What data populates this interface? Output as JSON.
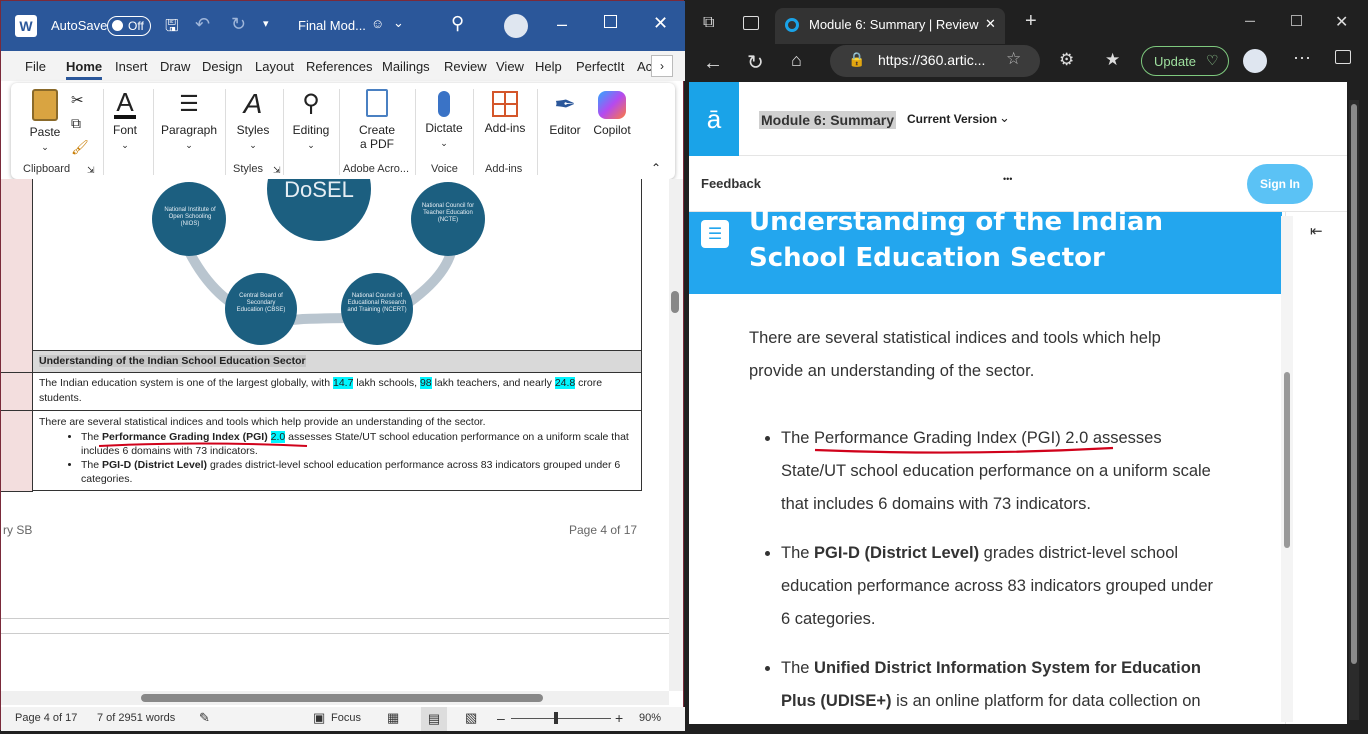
{
  "word": {
    "autosave_label": "AutoSave",
    "autosave_state": "Off",
    "doc_title": "Final Mod...",
    "menu": [
      "File",
      "Home",
      "Insert",
      "Draw",
      "Design",
      "Layout",
      "References",
      "Mailings",
      "Review",
      "View",
      "Help",
      "PerfectIt",
      "Ac"
    ],
    "ribbon": {
      "paste": "Paste",
      "font": "Font",
      "paragraph": "Paragraph",
      "styles": "Styles",
      "editing": "Editing",
      "create_pdf_1": "Create",
      "create_pdf_2": "a PDF",
      "dictate": "Dictate",
      "addins": "Add-ins",
      "editor": "Editor",
      "copilot": "Copilot"
    },
    "groups": {
      "clipboard": "Clipboard",
      "styles": "Styles",
      "adobe": "Adobe Acro...",
      "voice": "Voice",
      "addins": "Add-ins"
    },
    "diagram": {
      "center": "DoSEL",
      "nios": "National Institute of Open Schooling (NIOS)",
      "ncte": "National Council for Teacher Education (NCTE)",
      "cbse": "Central Board of Secondary Education (CBSE)",
      "ncert": "National Council of Educational Research and Training (NCERT)"
    },
    "table": {
      "heading": "Understanding of the Indian School Education Sector",
      "p1_a": "The Indian education system is one of the largest globally, with ",
      "p1_n1": "14.7",
      "p1_b": " lakh schools, ",
      "p1_n2": "98",
      "p1_c": " lakh teachers, and nearly ",
      "p1_n3": "24.8",
      "p1_d": " crore students.",
      "p2": "There are several statistical indices and tools which help provide an understanding of the sector.",
      "b1_a": "The ",
      "b1_bold": "Performance Grading Index (PGI) ",
      "b1_num": "2.0",
      "b1_b": " assesses State/UT school education performance on a uniform scale that includes 6 domains with 73 indicators.",
      "b2_a": "The ",
      "b2_bold": "PGI-D (District Level)",
      "b2_b": " grades district-level school education performance across 83 indicators grouped under 6 categories."
    },
    "footer_left": "ry SB",
    "footer_right": "Page 4 of 17",
    "status": {
      "page": "Page 4 of 17",
      "words": "7 of 2951 words",
      "focus": "Focus",
      "zoom": "90%"
    }
  },
  "browser": {
    "tab_title": "Module 6: Summary | Review 360",
    "url": "https://360.artic...",
    "update_label": "Update",
    "module_title": "Module 6: Summary",
    "version": "Current Version",
    "feedback": "Feedback",
    "more": "•••",
    "signin": "Sign In",
    "banner_line1": "Understanding of the Indian",
    "banner_line2": "School Education Sector",
    "intro": "There are several statistical indices and tools which help provide an understanding of the sector.",
    "b1_a": "The ",
    "b1_u": "Performance Grading Index (PGI) 2.0 as",
    "b1_b": "sesses State/UT school education performance on a uniform scale that includes 6  domains with  73 indicators.",
    "b2_a": "The ",
    "b2_bold": "PGI-D (District Level)",
    "b2_b": " grades district-level school education performance across 83 indicators grouped under 6 categories.",
    "b3_a": "The ",
    "b3_bold": "Unified District Information System for Education Plus (UDISE+)",
    "b3_b": " is an online platform for data collection on"
  },
  "colors": {
    "word_blue": "#2b579a",
    "accent_blue": "#23a6ee",
    "highlight": "#00f5ff",
    "diagram_teal": "#1c5f80"
  }
}
